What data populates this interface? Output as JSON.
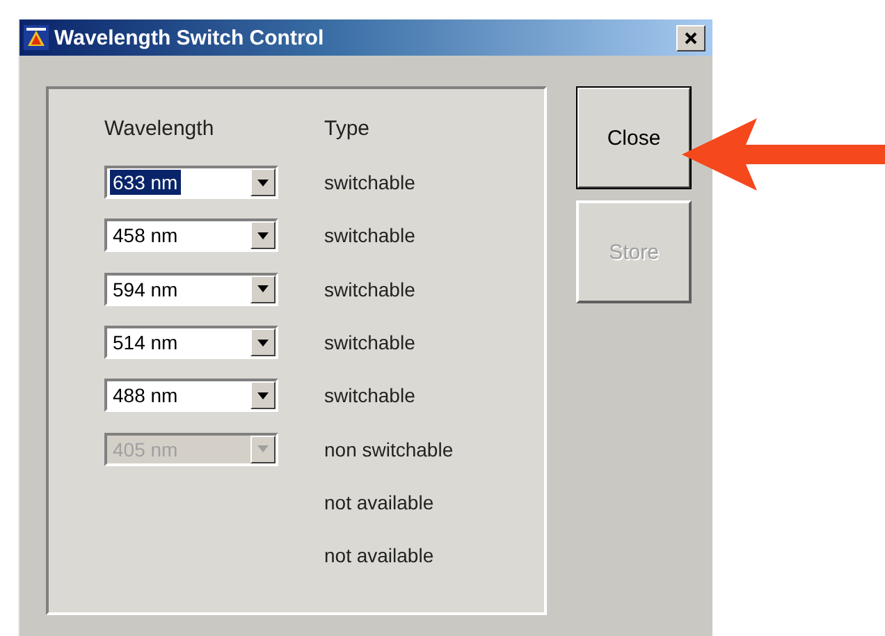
{
  "window": {
    "title": "Wavelength Switch Control"
  },
  "columns": [
    "Wavelength",
    "Type"
  ],
  "rows": [
    {
      "kind": "combo",
      "wavelength": "633 nm",
      "type": "switchable",
      "selected": true,
      "disabled": false
    },
    {
      "kind": "combo",
      "wavelength": "458 nm",
      "type": "switchable",
      "selected": false,
      "disabled": false
    },
    {
      "kind": "combo",
      "wavelength": "594 nm",
      "type": "switchable",
      "selected": false,
      "disabled": false
    },
    {
      "kind": "combo",
      "wavelength": "514 nm",
      "type": "switchable",
      "selected": false,
      "disabled": false
    },
    {
      "kind": "combo",
      "wavelength": "488 nm",
      "type": "switchable",
      "selected": false,
      "disabled": false
    },
    {
      "kind": "combo",
      "wavelength": "405 nm",
      "type": "non switchable",
      "selected": false,
      "disabled": true
    },
    {
      "kind": "text",
      "type": "not available"
    },
    {
      "kind": "text",
      "type": "not available"
    }
  ],
  "buttons": [
    {
      "label": "Close",
      "default": true,
      "disabled": false
    },
    {
      "label": "Store",
      "default": false,
      "disabled": true
    }
  ]
}
